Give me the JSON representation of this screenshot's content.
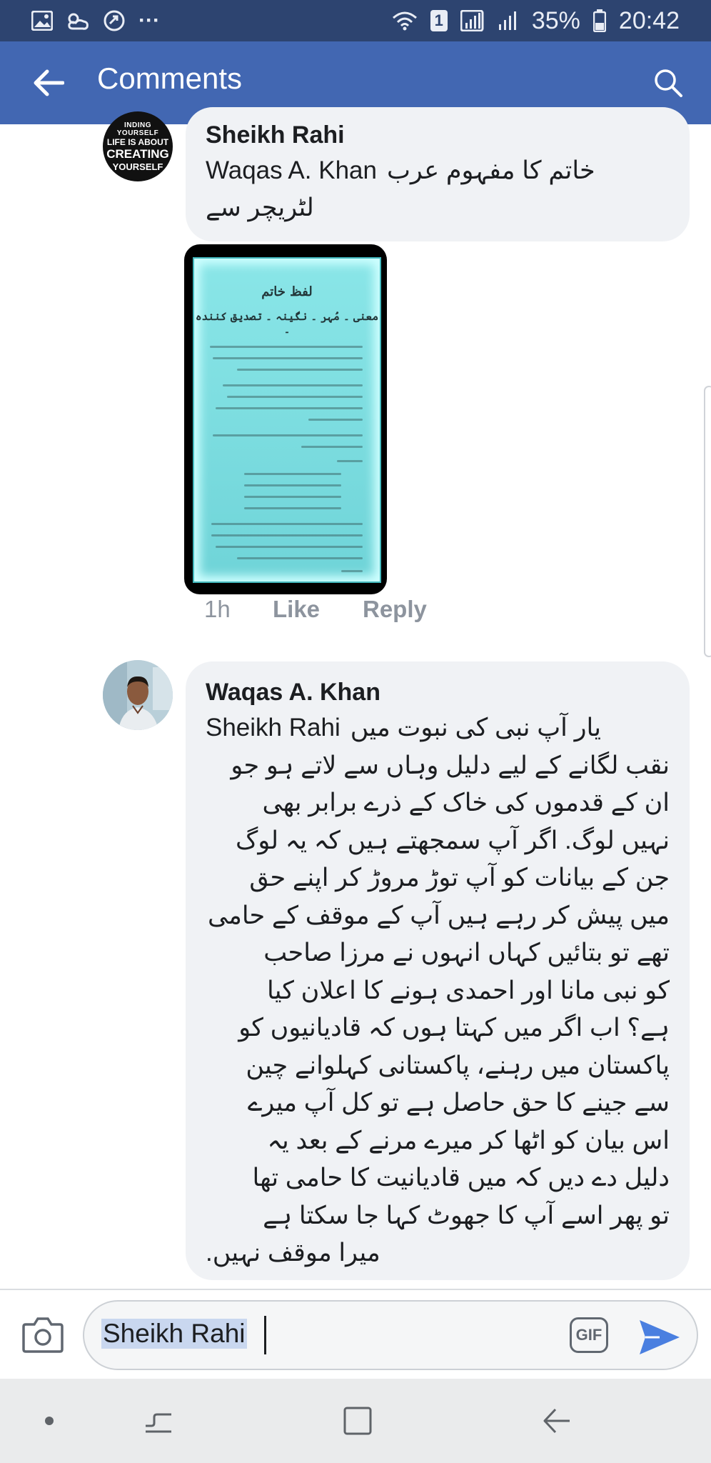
{
  "status_bar": {
    "notification_badge": "1",
    "battery": "35%",
    "time": "20:42",
    "overflow": "···"
  },
  "app_bar": {
    "title": "Comments"
  },
  "comments": [
    {
      "author": "Sheikh Rahi",
      "mention": "Waqas A. Khan",
      "text_line1": "خاتم کا مفہوم عرب",
      "text_line2": "لٹریچر سے",
      "avatar_text": [
        "INDING YOURSELF",
        "LIFE IS ABOUT",
        "CREATING",
        "YOURSELF"
      ],
      "attachment": {
        "title": "لفظ خاتم",
        "subtitle": "معنی ۔ مُہر ۔ نگینہ ۔ تصدیق کنندہ ۔"
      },
      "time": "1h",
      "like_label": "Like",
      "reply_label": "Reply"
    },
    {
      "author": "Waqas A. Khan",
      "mention": "Sheikh Rahi",
      "lines": [
        "یار آپ نبی کی نبوت میں",
        "نقب لگانے کے لیے دلیل وہاں سے لاتے ہو جو",
        "ان کے قدموں کی خاک کے ذرے برابر بھی",
        "نہیں لوگ. اگر آپ سمجھتے ہیں کہ یہ لوگ",
        "جن کے بیانات کو آپ توڑ مروڑ کر اپنے حق",
        "میں پیش کر رہے ہیں آپ کے موقف کے حامی",
        "تھے تو بتائیں کہاں انہوں نے مرزا صاحب",
        "کو نبی مانا اور احمدی ہونے کا اعلان کیا",
        "ہے؟ اب اگر میں کہتا ہوں کہ قادیانیوں کو",
        "پاکستان میں رہنے، پاکستانی کہلوانے چین",
        "سے جینے کا حق حاصل ہے تو کل آپ میرے",
        "اس بیان کو اٹھا کر میرے مرنے کے بعد یہ",
        "دلیل دے دیں کہ میں قادیانیت کا حامی تھا",
        "تو پھر اسے آپ کا جھوٹ کہا جا سکتا ہے",
        "میرا موقف نہیں."
      ]
    }
  ],
  "composer": {
    "value": "Sheikh Rahi",
    "gif_label": "GIF"
  }
}
